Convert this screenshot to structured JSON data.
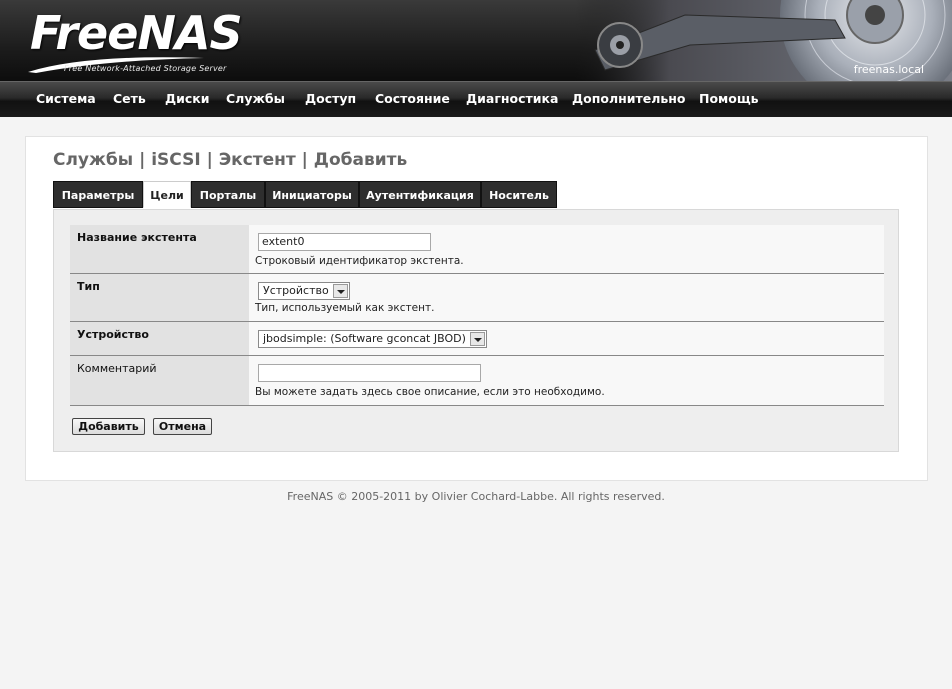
{
  "header": {
    "logo": "FreeNAS",
    "tagline": "Free Network-Attached Storage Server",
    "hostname": "freenas.local"
  },
  "nav": [
    "Система",
    "Сеть",
    "Диски",
    "Службы",
    "Доступ",
    "Состояние",
    "Диагностика",
    "Дополнительно",
    "Помощь"
  ],
  "page": {
    "title": "Службы | iSCSI | Экстент | Добавить",
    "tabs": [
      "Параметры",
      "Цели",
      "Порталы",
      "Инициаторы",
      "Аутентификация",
      "Носитель"
    ],
    "active_tab": "Цели"
  },
  "form": {
    "extent_name": {
      "label": "Название экстента",
      "value": "extent0",
      "description": "Строковый идентификатор экстента."
    },
    "type": {
      "label": "Тип",
      "value": "Устройство",
      "description": "Тип, используемый как экстент."
    },
    "device": {
      "label": "Устройство",
      "value": "jbodsimple: (Software gconcat JBOD)"
    },
    "comment": {
      "label": "Комментарий",
      "value": "",
      "description": "Вы можете задать здесь свое описание, если это необходимо."
    },
    "buttons": {
      "add": "Добавить",
      "cancel": "Отмена"
    }
  },
  "footer": "FreeNAS © 2005-2011 by Olivier Cochard-Labbe. All rights reserved.",
  "colors": {
    "header_bg": "#1c1c1c",
    "nav_bg": "#2a2a2a",
    "tab_bg": "#2e2e2e",
    "page_bg": "#f4f4f4",
    "title": "#666666"
  }
}
